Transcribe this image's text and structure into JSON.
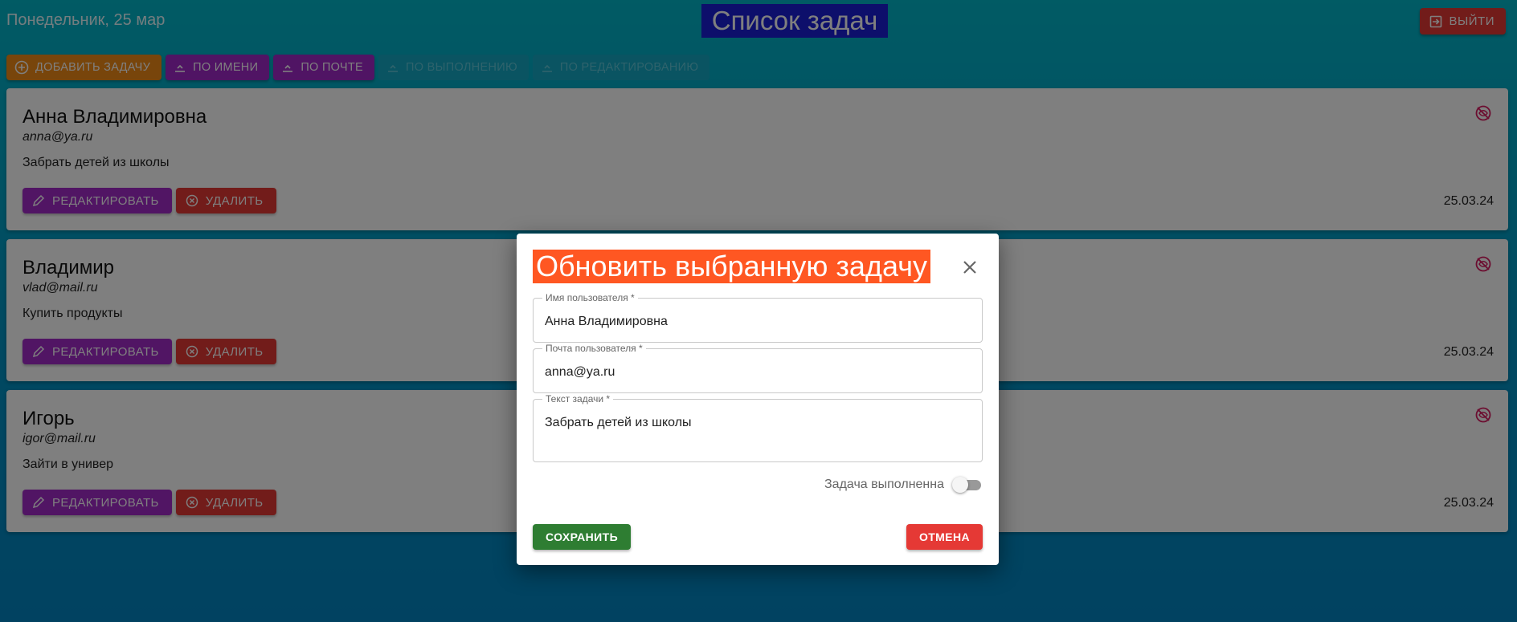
{
  "header": {
    "date": "Понедельник, 25 мар",
    "title": "Список задач",
    "logout_label": "ВЫЙТИ"
  },
  "toolbar": {
    "add_label": "ДОБАВИТЬ ЗАДАЧУ",
    "sort_name_label": "ПО ИМЕНИ",
    "sort_email_label": "ПО ПОЧТЕ",
    "sort_done_label": "ПО ВЫПОЛНЕНИЮ",
    "sort_edited_label": "ПО РЕДАКТИРОВАНИЮ"
  },
  "tasks": [
    {
      "name": "Анна Владимировна",
      "email": "anna@ya.ru",
      "text": "Забрать детей из школы",
      "date": "25.03.24",
      "edit_label": "РЕДАКТИРОВАТЬ",
      "delete_label": "УДАЛИТЬ",
      "status_icon": "not-done-icon"
    },
    {
      "name": "Владимир",
      "email": "vlad@mail.ru",
      "text": "Купить продукты",
      "date": "25.03.24",
      "edit_label": "РЕДАКТИРОВАТЬ",
      "delete_label": "УДАЛИТЬ",
      "status_icon": "not-done-icon"
    },
    {
      "name": "Игорь",
      "email": "igor@mail.ru",
      "text": "Зайти в универ",
      "date": "25.03.24",
      "edit_label": "РЕДАКТИРОВАТЬ",
      "delete_label": "УДАЛИТЬ",
      "status_icon": "not-done-icon"
    }
  ],
  "modal": {
    "title": "Обновить выбранную задачу",
    "username_label": "Имя пользователя *",
    "username_value": "Анна Владимировна",
    "email_label": "Почта пользователя *",
    "email_value": "anna@ya.ru",
    "text_label": "Текст задачи *",
    "text_value": "Забрать детей из школы",
    "done_label": "Задача выполненна",
    "done_checked": false,
    "save_label": "СОХРАНИТЬ",
    "cancel_label": "ОТМЕНА"
  },
  "colors": {
    "accent_orange": "#f08a17",
    "accent_purple": "#a128c8",
    "danger_red": "#e53935",
    "save_green": "#2e7d32",
    "title_blue": "#1a1fd6",
    "modal_title_orange": "#ff5722"
  }
}
